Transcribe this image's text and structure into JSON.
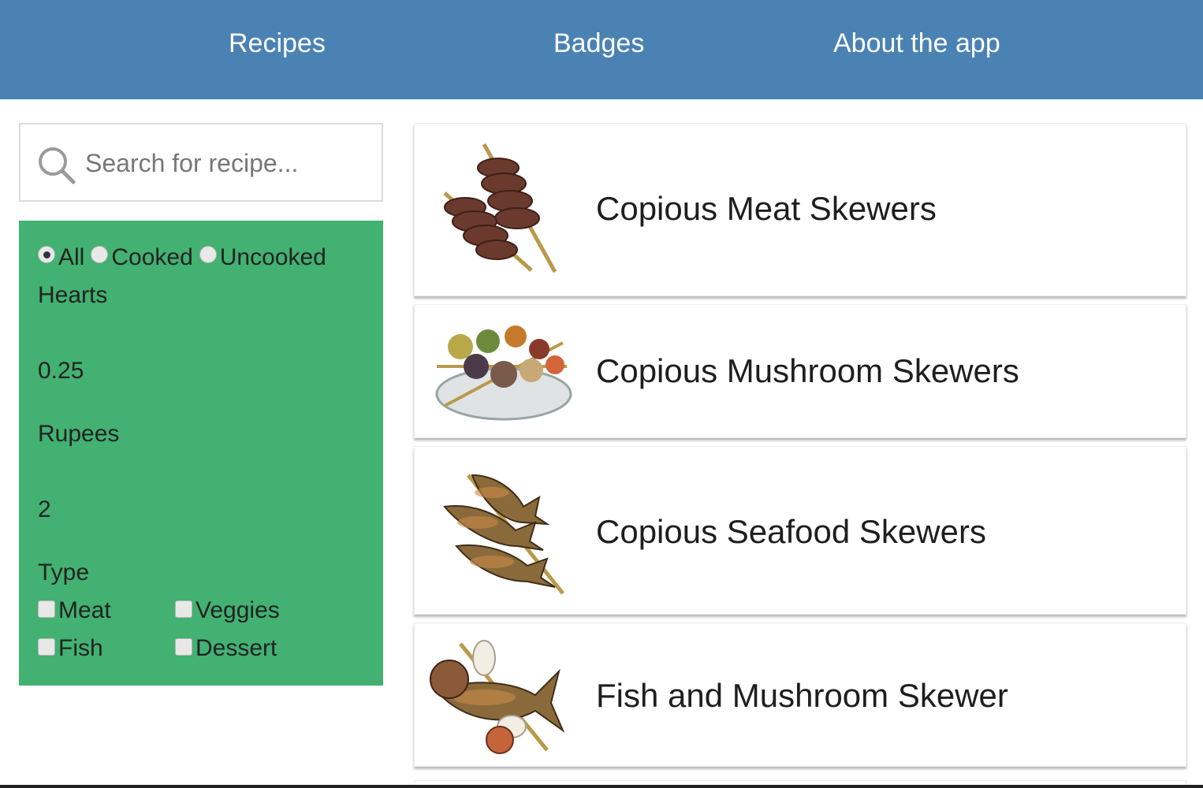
{
  "nav": {
    "recipes": "Recipes",
    "badges": "Badges",
    "about": "About the app"
  },
  "search": {
    "placeholder": "Search for recipe..."
  },
  "filters": {
    "radios": [
      {
        "label": "All",
        "checked": true
      },
      {
        "label": "Cooked",
        "checked": false
      },
      {
        "label": "Uncooked",
        "checked": false
      }
    ],
    "hearts_label": "Hearts",
    "hearts_value": "0.25",
    "rupees_label": "Rupees",
    "rupees_value": "2",
    "type_label": "Type",
    "types": [
      {
        "label": "Meat",
        "checked": false
      },
      {
        "label": "Veggies",
        "checked": false
      },
      {
        "label": "Fish",
        "checked": false
      },
      {
        "label": "Dessert",
        "checked": false
      }
    ]
  },
  "recipes": [
    {
      "title": "Copious Meat Skewers",
      "image": "meat-skewers-image"
    },
    {
      "title": "Copious Mushroom Skewers",
      "image": "mushroom-skewers-image"
    },
    {
      "title": "Copious Seafood Skewers",
      "image": "seafood-skewers-image"
    },
    {
      "title": "Fish and Mushroom Skewer",
      "image": "fish-mushroom-skewer-image"
    }
  ],
  "colors": {
    "nav_bg": "#4a82b3",
    "filter_bg": "#42b171"
  }
}
